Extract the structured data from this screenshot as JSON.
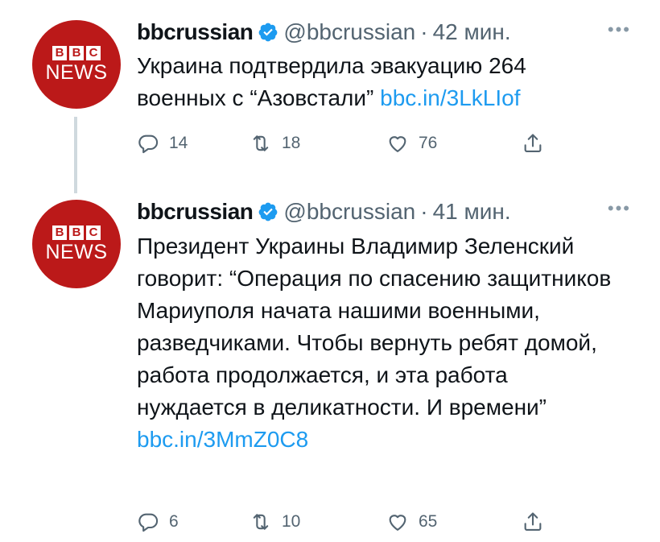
{
  "tweets": [
    {
      "avatar": {
        "logo_letters": [
          "B",
          "B",
          "C"
        ],
        "logo_word": "NEWS",
        "color": "#bb1919"
      },
      "display_name": "bbcrussian",
      "handle": "@bbcrussian",
      "separator": "·",
      "time": "42 мин.",
      "text": "Украина подтвердила эвакуацию 264 военных с “Азовстали”",
      "link": "bbc.in/3LkLIof",
      "replies": "14",
      "retweets": "18",
      "likes": "76"
    },
    {
      "avatar": {
        "logo_letters": [
          "B",
          "B",
          "C"
        ],
        "logo_word": "NEWS",
        "color": "#bb1919"
      },
      "display_name": "bbcrussian",
      "handle": "@bbcrussian",
      "separator": "·",
      "time": "41 мин.",
      "text": "Президент Украины Владимир Зеленский говорит: “Операция по спасению защитников Мариуполя начата нашими военными, разведчиками. Чтобы вернуть ребят домой, работа продолжается, и эта работа нуждается в деликатности. И времени”",
      "link": "bbc.in/3MmZ0C8",
      "replies": "6",
      "retweets": "10",
      "likes": "65"
    }
  ],
  "icons": {
    "more": "more-horizontal-icon",
    "verified": "verified-badge-icon",
    "reply": "reply-icon",
    "retweet": "retweet-icon",
    "like": "heart-icon",
    "share": "share-icon"
  },
  "colors": {
    "link": "#1d9bf0",
    "verified": "#1d9bf0",
    "muted": "#536471",
    "thread_line": "#cfd9de"
  }
}
